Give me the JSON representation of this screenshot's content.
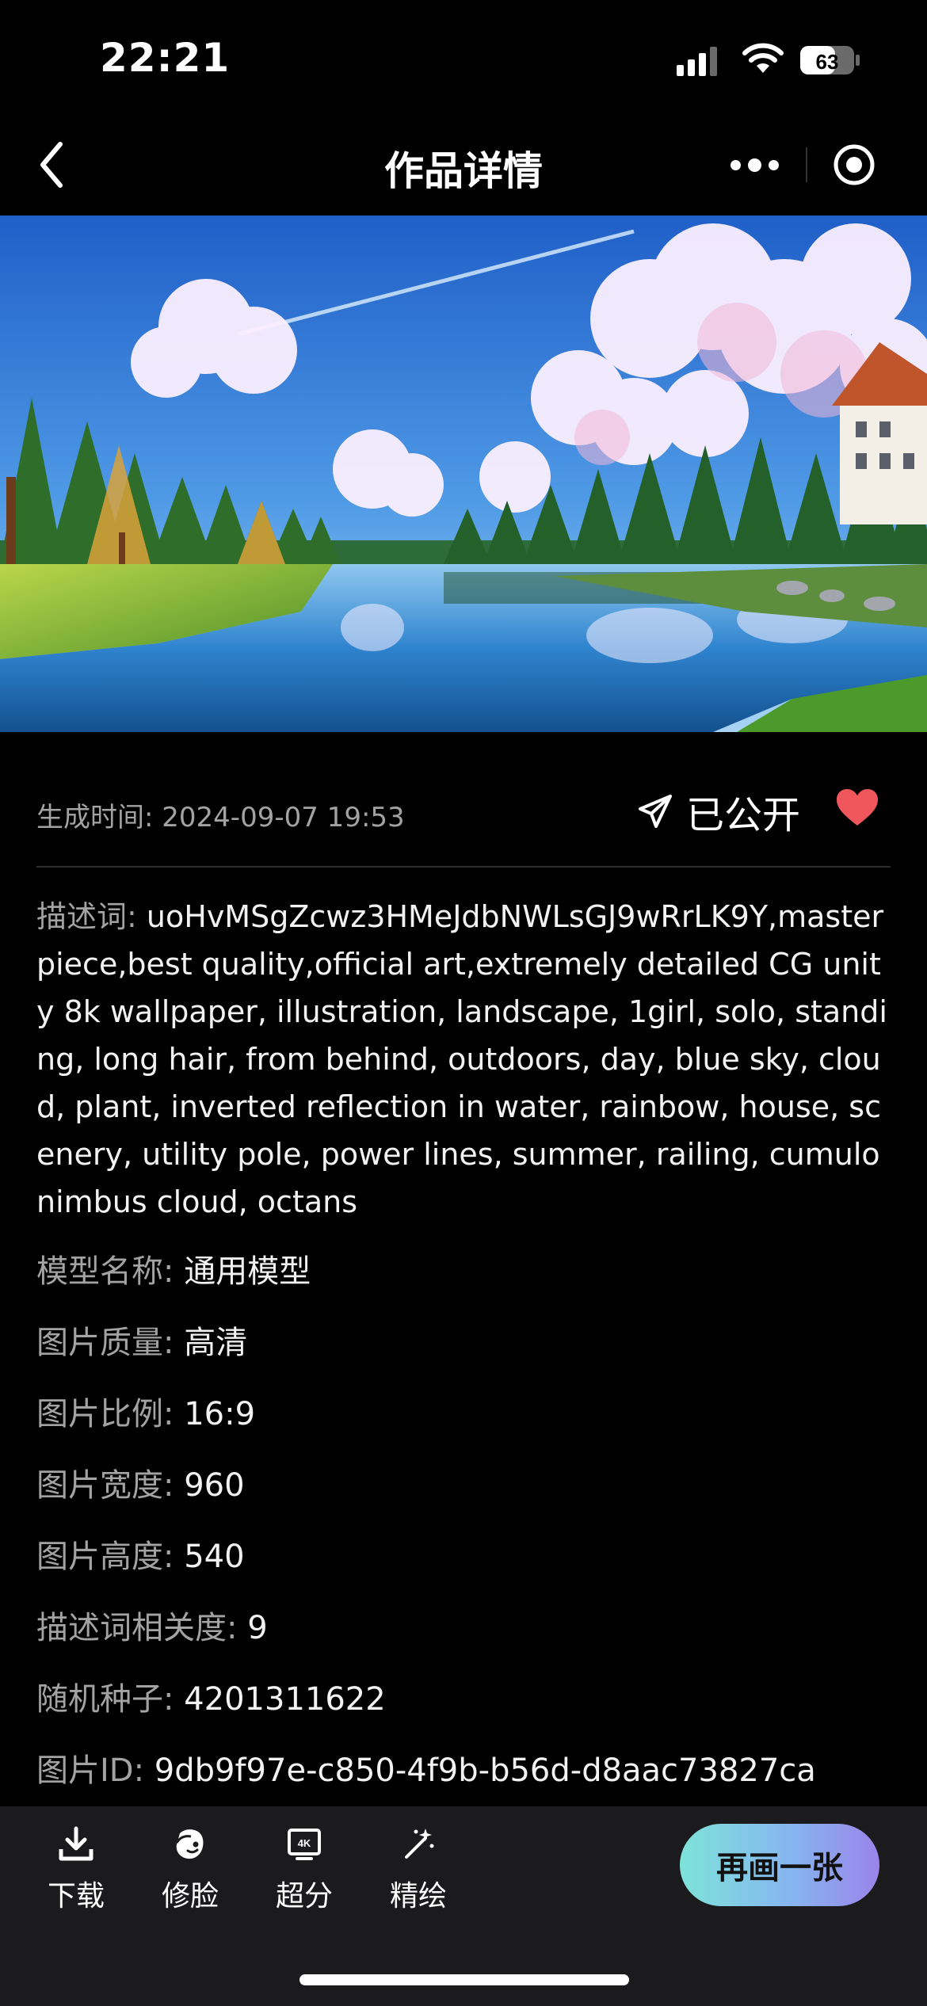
{
  "status_bar": {
    "time": "22:21",
    "battery": "63"
  },
  "nav": {
    "title": "作品详情"
  },
  "meta": {
    "gen_time_label": "生成时间:",
    "gen_time_value": "2024-09-07 19:53",
    "publish_label": "已公开"
  },
  "description": {
    "label": "描述词:",
    "text": "uoHvMSgZcwz3HMeJdbNWLsGJ9wRrLK9Y,masterpiece,best quality,official art,extremely detailed CG unity 8k wallpaper, illustration, landscape, 1girl, solo, standing, long hair, from behind, outdoors, day, blue sky, cloud, plant, inverted reflection in water, rainbow, house, scenery, utility pole, power lines, summer, railing, cumulonimbus cloud, octans"
  },
  "details": [
    {
      "label": "模型名称:",
      "value": "通用模型"
    },
    {
      "label": "图片质量:",
      "value": "高清"
    },
    {
      "label": "图片比例:",
      "value": "16:9"
    },
    {
      "label": "图片宽度:",
      "value": "960"
    },
    {
      "label": "图片高度:",
      "value": "540"
    },
    {
      "label": "描述词相关度:",
      "value": "9"
    },
    {
      "label": "随机种子:",
      "value": "4201311622"
    },
    {
      "label": "图片ID:",
      "value": "9db9f97e-c850-4f9b-b56d-d8aac73827ca"
    }
  ],
  "toolbar": {
    "download_label": "下载",
    "face_fix_label": "修脸",
    "upscale_label": "超分",
    "refine_label": "精绘",
    "redraw_label": "再画一张"
  },
  "colors": {
    "background": "#000000",
    "label_gray": "#a3a3a3",
    "like_red": "#f0575c",
    "toolbar_bg": "#1b1b1d",
    "button_gradient_start": "#7ee3d9",
    "button_gradient_end": "#9a84ea"
  },
  "icons": [
    "signal-icon",
    "wifi-icon",
    "battery-icon",
    "back-arrow-icon",
    "more-dots-icon",
    "close-circle-icon",
    "send-icon",
    "heart-icon",
    "download-icon",
    "face-fix-icon",
    "4k-icon",
    "magic-wand-icon"
  ]
}
